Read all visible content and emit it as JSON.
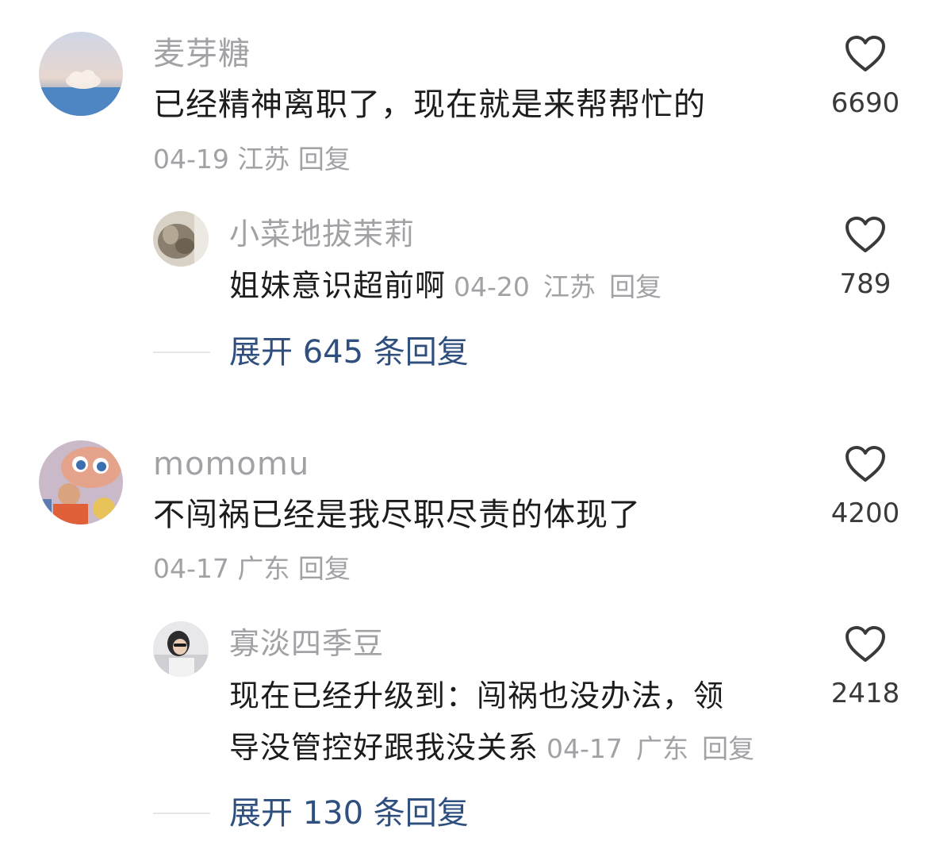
{
  "comments": [
    {
      "username": "麦芽糖",
      "text": "已经精神离职了，现在就是来帮帮忙的",
      "date": "04-19",
      "location": "江苏",
      "reply_label": "回复",
      "likes": "6690",
      "like_icon": "heart-outline-icon",
      "sub_reply": {
        "username": "小菜地拔茉莉",
        "text": "姐妹意识超前啊",
        "date": "04-20",
        "location": "江苏",
        "reply_label": "回复",
        "likes": "789"
      },
      "expand_label": "展开 645 条回复"
    },
    {
      "username": "momomu",
      "text": "不闯祸已经是我尽职尽责的体现了",
      "date": "04-17",
      "location": "广东",
      "reply_label": "回复",
      "likes": "4200",
      "sub_reply": {
        "username": "寡淡四季豆",
        "text_line1": "现在已经升级到：闯祸也没办法，领",
        "text_line2": "导没管控好跟我没关系",
        "date": "04-17",
        "location": "广东",
        "reply_label": "回复",
        "likes": "2418"
      },
      "expand_label": "展开 130 条回复"
    }
  ],
  "colors": {
    "name": "#a2a2a6",
    "text": "#1c1c1e",
    "link": "#2f4f7f",
    "divider": "#e6e6e6"
  }
}
